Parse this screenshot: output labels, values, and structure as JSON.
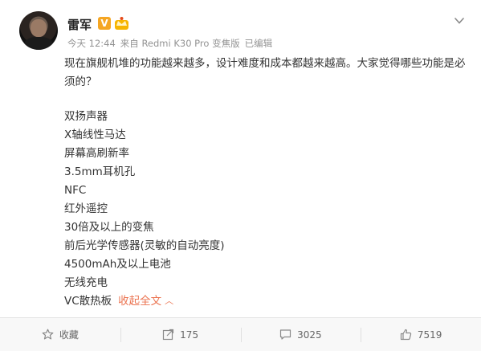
{
  "post": {
    "author": "雷军",
    "verified_badge": "V",
    "meta": {
      "time": "今天 12:44",
      "source": "来自 Redmi K30 Pro 变焦版",
      "edited": "已编辑"
    },
    "text": "现在旗舰机堆的功能越来越多，设计难度和成本都越来越高。大家觉得哪些功能是必须的？",
    "features": [
      "双扬声器",
      "X轴线性马达",
      "屏幕高刷新率",
      "3.5mm耳机孔",
      "NFC",
      "红外遥控",
      "30倍及以上的变焦",
      "前后光学传感器(灵敏的自动亮度)",
      "4500mAh及以上电池",
      "无线充电",
      "VC散热板"
    ],
    "collapse_label": "收起全文",
    "collapse_icon": "chevron-up-icon"
  },
  "toolbar": {
    "favorite": "收藏",
    "repost": "175",
    "comment": "3025",
    "like": "7519"
  },
  "colors": {
    "accent": "#eb7350",
    "meta_text": "#939393",
    "badge": "#f5a623"
  }
}
